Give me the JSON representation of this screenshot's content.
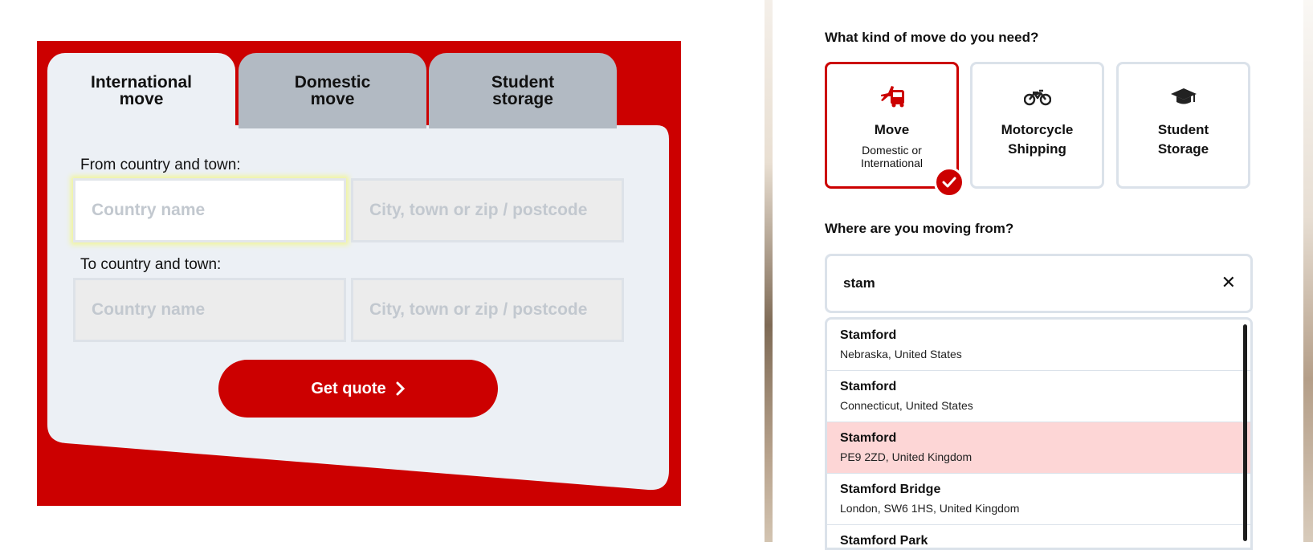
{
  "left_form": {
    "tabs": [
      {
        "line1": "International",
        "line2": "move"
      },
      {
        "line1": "Domestic",
        "line2": "move"
      },
      {
        "line1": "Student",
        "line2": "storage"
      }
    ],
    "from_label": "From country and town:",
    "to_label": "To country and town:",
    "country_placeholder": "Country name",
    "city_placeholder": "City, town or zip / postcode",
    "get_quote_label": "Get quote",
    "colors": {
      "brand_red": "#cc0000",
      "card_bg": "#ecf0f5",
      "tab_inactive": "#b2bac3"
    }
  },
  "right_form": {
    "move_kind_question": "What kind of move do you need?",
    "options": [
      {
        "title": "Move",
        "subtitle_line1": "Domestic or",
        "subtitle_line2": "International",
        "icon": "truck-plane-icon",
        "selected": true
      },
      {
        "title_line1": "Motorcycle",
        "title_line2": "Shipping",
        "icon": "motorcycle-icon",
        "selected": false
      },
      {
        "title_line1": "Student",
        "title_line2": "Storage",
        "icon": "graduation-cap-icon",
        "selected": false
      }
    ],
    "moving_from_question": "Where are you moving from?",
    "search_value": "stam",
    "suggestions": [
      {
        "name": "Stamford",
        "detail": "Nebraska, United States"
      },
      {
        "name": "Stamford",
        "detail": "Connecticut, United States"
      },
      {
        "name": "Stamford",
        "detail": "PE9 2ZD, United Kingdom"
      },
      {
        "name": "Stamford Bridge",
        "detail": "London, SW6 1HS, United Kingdom"
      },
      {
        "name": "Stamford Park",
        "detail": ""
      }
    ],
    "highlighted_suggestion_index": 2
  }
}
